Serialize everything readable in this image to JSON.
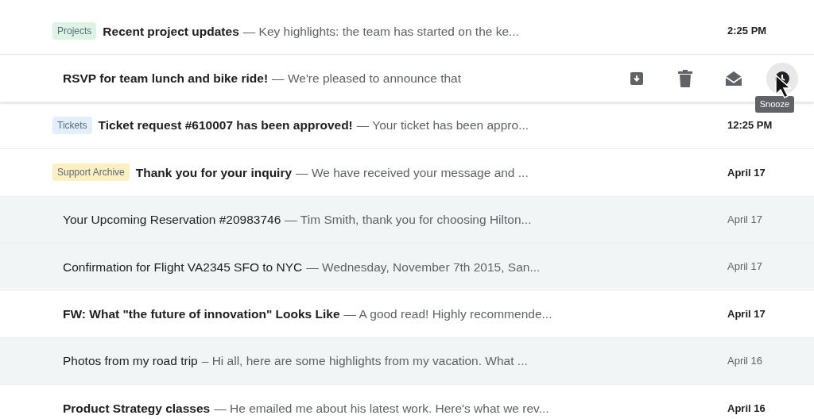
{
  "emails": [
    {
      "read": false,
      "tag": {
        "label": "Projects",
        "color": "#ddf3e4"
      },
      "subject": "Recent project updates",
      "snippet": "— Key highlights: the team has started on the ke...",
      "date": "2:25 PM"
    },
    {
      "read": false,
      "subject": "RSVP for team lunch and bike ride!",
      "snippet": "— We're pleased to announce that",
      "actions": [
        {
          "kind": "archive",
          "active": false
        },
        {
          "kind": "delete",
          "active": false
        },
        {
          "kind": "mark_read",
          "active": false
        },
        {
          "kind": "snooze",
          "active": true,
          "tooltip": "Snooze"
        }
      ]
    },
    {
      "read": false,
      "tag": {
        "label": "Tickets",
        "color": "#e3eefc"
      },
      "subject": "Ticket request #610007 has been approved!",
      "snippet": "— Your ticket has been appro...",
      "date": "12:25 PM"
    },
    {
      "read": false,
      "tag": {
        "label": "Support Archive",
        "color": "#fcefc0"
      },
      "subject": "Thank you for your inquiry",
      "snippet": "— We have received your message and ...",
      "date": "April 17"
    },
    {
      "read": true,
      "subject": "Your Upcoming Reservation #20983746",
      "snippet": "— Tim Smith, thank you for choosing Hilton...",
      "date": "April 17"
    },
    {
      "read": true,
      "subject": "Confirmation for Flight VA2345 SFO to NYC",
      "snippet": "— Wednesday, November 7th 2015, San...",
      "date": "April 17"
    },
    {
      "read": false,
      "subject": "FW: What \"the future of innovation\" Looks Like",
      "snippet": "— A good read! Highly recommende...",
      "date": "April 17"
    },
    {
      "read": true,
      "subject": "Photos from my road trip",
      "snippet": "– Hi all, here are some highlights from my vacation. What ...",
      "date": "April 16"
    },
    {
      "read": false,
      "subject": "Product Strategy classes",
      "snippet": "— He emailed me about his latest work. Here's what we rev...",
      "date": "April 16"
    }
  ]
}
